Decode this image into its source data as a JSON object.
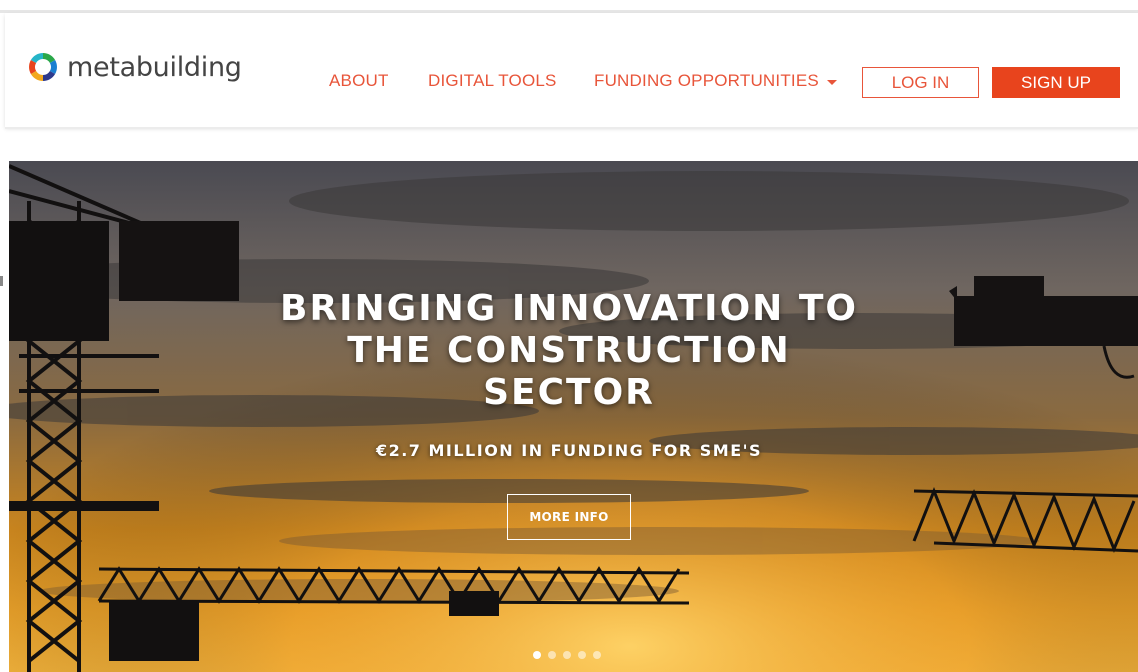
{
  "header": {
    "logo_text": "metabuilding",
    "nav": [
      {
        "label": "ABOUT"
      },
      {
        "label": "DIGITAL TOOLS"
      },
      {
        "label": "FUNDING OPPORTUNITIES"
      }
    ],
    "login_label": "LOG IN",
    "signup_label": "SIGN UP"
  },
  "hero": {
    "title_lines": [
      "BRINGING INNOVATION TO",
      "THE CONSTRUCTION",
      "SECTOR"
    ],
    "subtitle": "€2.7 MILLION IN FUNDING FOR SME'S",
    "button_label": "MORE INFO",
    "slides": 5,
    "active_slide": 1
  },
  "colors": {
    "accent": "#e8553a",
    "signup_bg": "#e8441d"
  }
}
